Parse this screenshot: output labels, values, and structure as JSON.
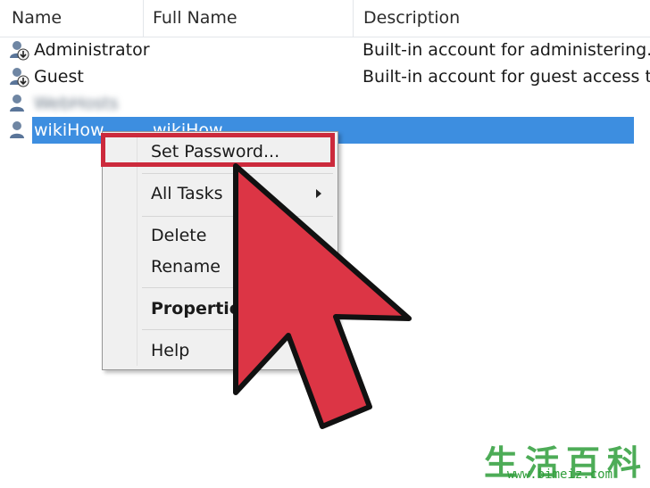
{
  "columns": {
    "name": "Name",
    "full_name": "Full Name",
    "description": "Description"
  },
  "users": [
    {
      "name": "Administrator",
      "full_name": "",
      "description": "Built-in account for administering..."
    },
    {
      "name": "Guest",
      "full_name": "",
      "description": "Built-in account for guest access t..."
    },
    {
      "name": "WebHosts",
      "full_name": "",
      "description": ""
    },
    {
      "name": "wikiHow",
      "full_name": "wikiHow",
      "description": ""
    }
  ],
  "context_menu": {
    "set_password": "Set Password...",
    "all_tasks": "All Tasks",
    "delete": "Delete",
    "rename": "Rename",
    "properties": "Properties",
    "help": "Help"
  },
  "watermark": {
    "text": "生活百科",
    "url": "www.bimeiz.com"
  },
  "colors": {
    "selection": "#3d8ee0",
    "highlight": "#cc2a3c",
    "cursor_fill": "#dc3545",
    "watermark": "#2f9e3a"
  },
  "icons": {
    "user": "user-icon",
    "submenu": "chevron-right-icon",
    "cursor": "arrow-cursor-icon"
  }
}
